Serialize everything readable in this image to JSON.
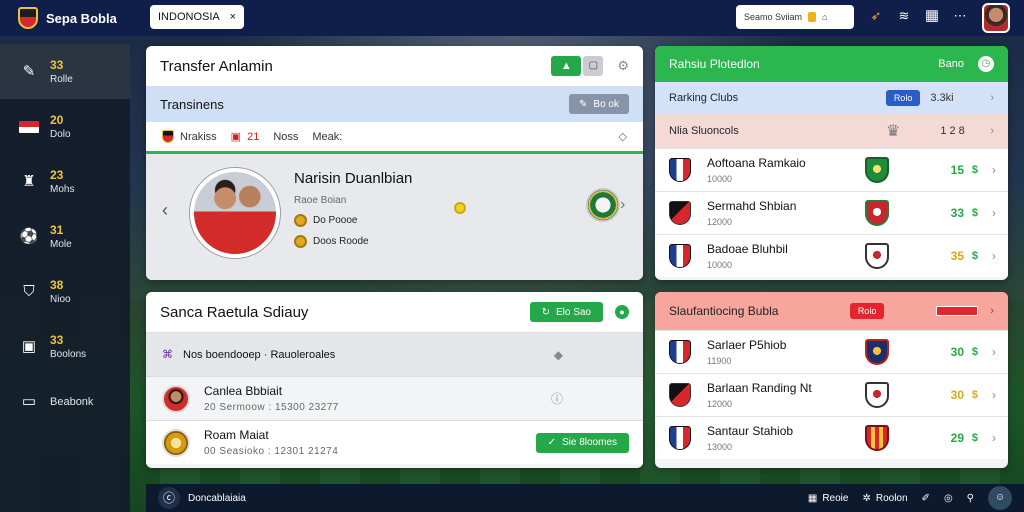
{
  "app": {
    "name": "Sepa Bobla"
  },
  "country_select": {
    "value": "INDONOSIA",
    "close": "×"
  },
  "top_search": {
    "label": "Seamo Sviiam"
  },
  "sidebar": {
    "items": [
      {
        "num": "33",
        "label": "Rolle",
        "icon": "whistle-icon"
      },
      {
        "num": "20",
        "label": "Dolo",
        "icon": "flag-icon"
      },
      {
        "num": "23",
        "label": "Mohs",
        "icon": "jersey-icon"
      },
      {
        "num": "31",
        "label": "Mole",
        "icon": "ball-icon"
      },
      {
        "num": "38",
        "label": "Nioo",
        "icon": "shield-icon"
      },
      {
        "num": "33",
        "label": "Boolons",
        "icon": "calendar-icon"
      },
      {
        "num": "",
        "label": "Beabonk",
        "icon": "screen-icon"
      }
    ]
  },
  "transfer": {
    "title": "Transfer Anlamin",
    "subtitle": "Transinens",
    "chip": "Bo ok",
    "tabs": [
      "Nrakiss",
      "21",
      "Noss",
      "Meak:"
    ],
    "player": {
      "name": "Narisin Duanlbian",
      "position": "Raoe Boian",
      "fee": "Do Poooe",
      "value": "Doos Roode"
    }
  },
  "squad": {
    "title": "Sanca Raetula Sdiauy",
    "button": "Elo Sao",
    "rows": [
      {
        "name": "Nos boendooep · Rauoleroales",
        "meta": ""
      },
      {
        "name": "Canlea Bbbiait",
        "meta": "20  Sermoow  :  15300  23277"
      },
      {
        "name": "Roam Maiat",
        "meta": "00  Seasioko  :  12301  21274",
        "button": "Sie 8loomes"
      }
    ]
  },
  "ranking": {
    "header": "Rahsiu Plotedlon",
    "header_right": "Bano",
    "bar1": {
      "label": "Rarking Clubs",
      "pill": "Rolo",
      "right": "3.3ki"
    },
    "bar2": {
      "label": "Nlia  Sluoncols",
      "right": "1 2 8"
    },
    "rows": [
      {
        "name": "Aoftoana Ramkaio",
        "sub": "10000",
        "pts": "15",
        "trend": "$"
      },
      {
        "name": "Sermahd Shbian",
        "sub": "12000",
        "pts": "33",
        "trend": "$"
      },
      {
        "name": "Badoae Bluhbil",
        "sub": "10000",
        "pts": "35",
        "trend": "$"
      }
    ]
  },
  "relegation": {
    "header": "Slaufantiocing Bubla",
    "pill": "Rolo",
    "rows": [
      {
        "name": "Sarlaer P5hiob",
        "sub": "11900",
        "pts": "30",
        "trend": "$"
      },
      {
        "name": "Barlaan Randing Nt",
        "sub": "12000",
        "pts": "30",
        "trend": "$"
      },
      {
        "name": "Santaur Stahiob",
        "sub": "13000",
        "pts": "29",
        "trend": "$"
      }
    ]
  },
  "footer": {
    "left": "Doncablaiaia",
    "item1": "Reoie",
    "item2": "Roolon"
  },
  "colors": {
    "accent_green": "#25a84a",
    "header_navy": "#0f1f4a",
    "alert_red": "#e2262c",
    "highlight_gold": "#f0c43b"
  }
}
